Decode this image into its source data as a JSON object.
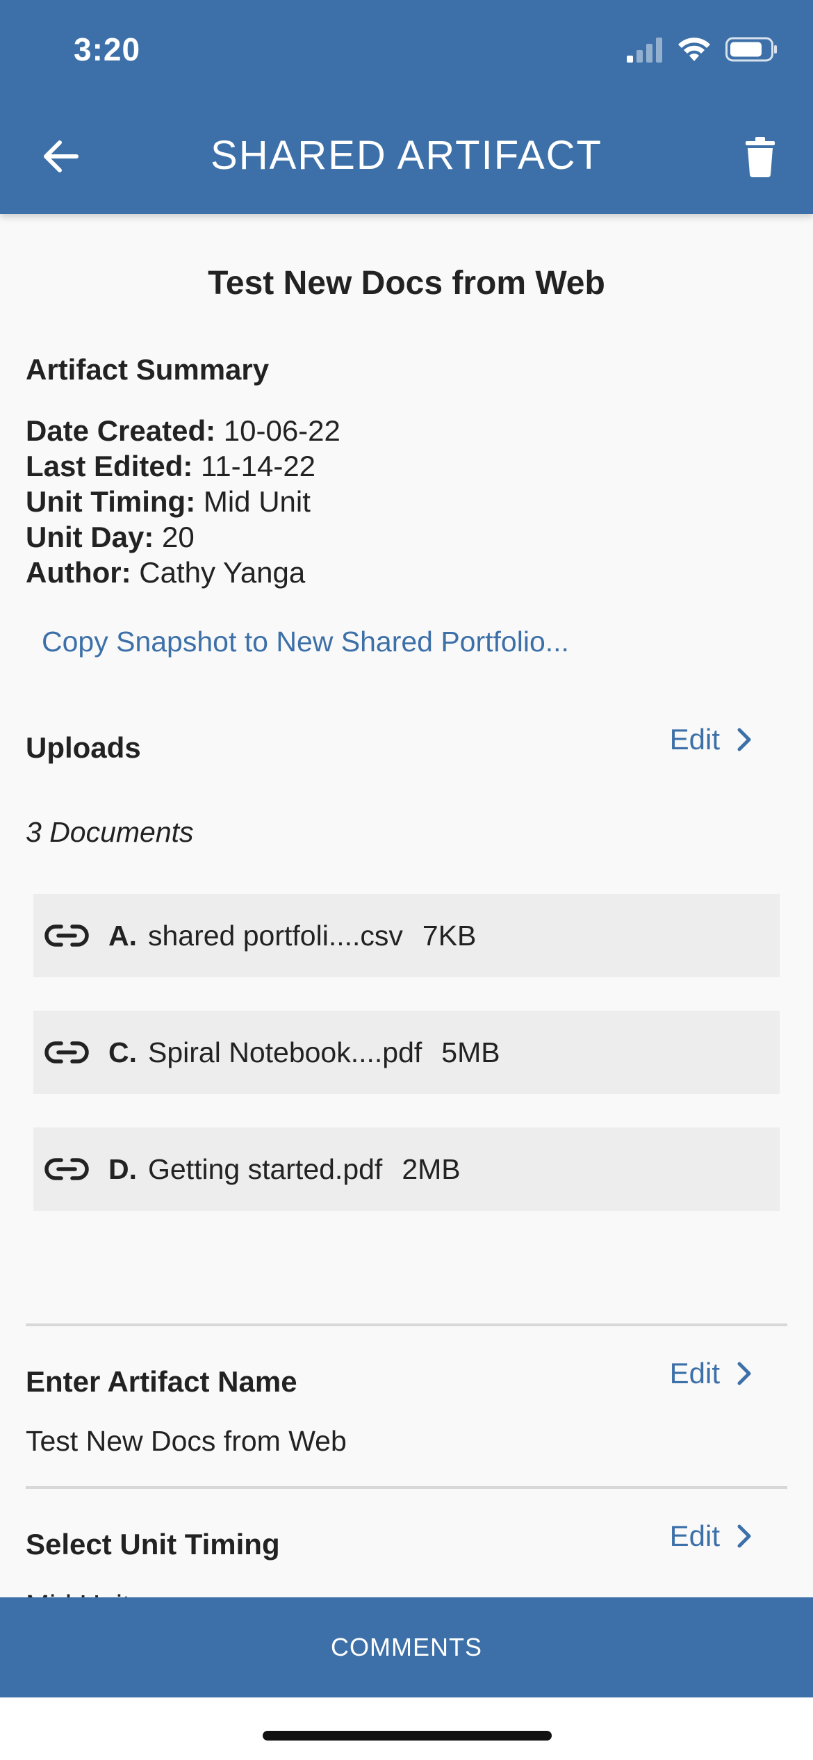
{
  "status_bar": {
    "time": "3:20"
  },
  "header": {
    "title": "SHARED ARTIFACT"
  },
  "artifact": {
    "title": "Test New Docs from Web",
    "summary_heading": "Artifact Summary",
    "meta": [
      {
        "label": "Date Created:",
        "value": "10-06-22"
      },
      {
        "label": "Last Edited:",
        "value": "11-14-22"
      },
      {
        "label": "Unit Timing:",
        "value": "Mid Unit"
      },
      {
        "label": "Unit Day:",
        "value": "20"
      },
      {
        "label": "Author:",
        "value": "Cathy Yanga"
      }
    ],
    "copy_link": "Copy Snapshot to New Shared Portfolio..."
  },
  "uploads": {
    "heading": "Uploads",
    "edit_label": "Edit",
    "count_label": "3 Documents",
    "documents": [
      {
        "letter": "A.",
        "name": "shared portfoli....csv",
        "size": "7KB"
      },
      {
        "letter": "C.",
        "name": "Spiral Notebook....pdf",
        "size": "5MB"
      },
      {
        "letter": "D.",
        "name": "Getting started.pdf",
        "size": "2MB"
      }
    ]
  },
  "artifact_name_section": {
    "heading": "Enter Artifact Name",
    "edit_label": "Edit",
    "value": "Test New Docs from Web"
  },
  "unit_timing_section": {
    "heading": "Select Unit Timing",
    "edit_label": "Edit",
    "value": "Mid Unit"
  },
  "bottom_bar": {
    "label": "COMMENTS"
  },
  "colors": {
    "accent": "#3d70a8",
    "row_bg": "#ededed",
    "page_bg": "#f9f9f9"
  }
}
